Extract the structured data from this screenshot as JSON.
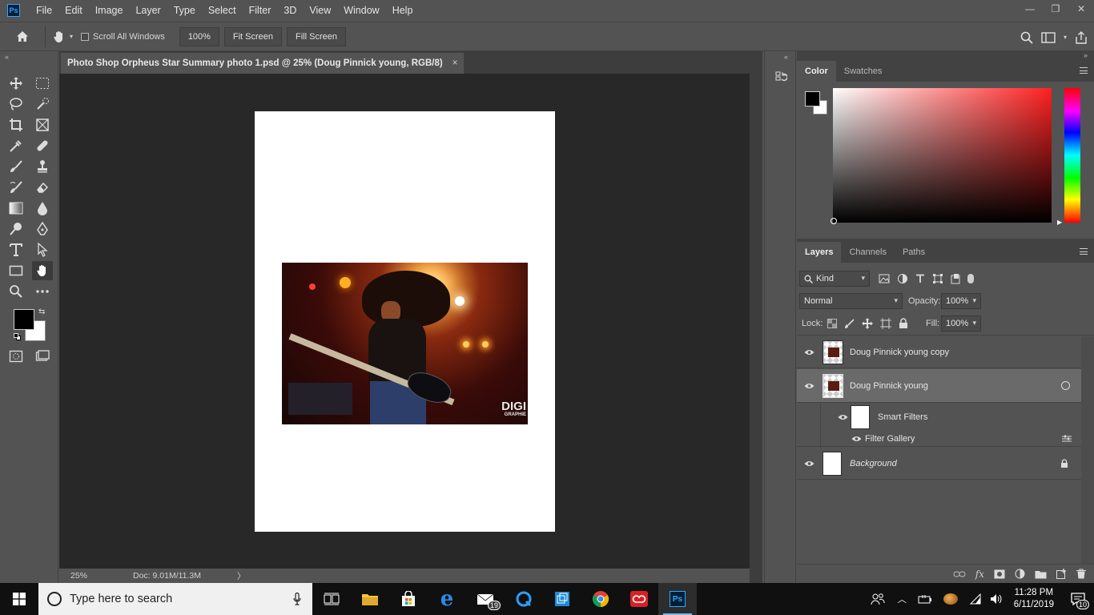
{
  "app": {
    "logo_text": "Ps",
    "menu": [
      "File",
      "Edit",
      "Image",
      "Layer",
      "Type",
      "Select",
      "Filter",
      "3D",
      "View",
      "Window",
      "Help"
    ],
    "window_controls": [
      "—",
      "❐",
      "✕"
    ]
  },
  "options_bar": {
    "scroll_all_windows": "Scroll All Windows",
    "zoom_value": "100%",
    "fit_screen": "Fit Screen",
    "fill_screen": "Fill Screen"
  },
  "document": {
    "tab_title": "Photo Shop Orpheus Star Summary photo 1.psd @ 25% (Doug Pinnick young, RGB/8)",
    "close": "×",
    "status_zoom": "25%",
    "status_doc": "Doc: 9.01M/11.3M",
    "status_arrow": "〉"
  },
  "photo": {
    "watermark": "DIGI",
    "watermark_sub": "GRAPHIE"
  },
  "color_panel": {
    "tabs": [
      "Color",
      "Swatches"
    ],
    "active_tab": "Color"
  },
  "layers_panel": {
    "tabs": [
      "Layers",
      "Channels",
      "Paths"
    ],
    "active_tab": "Layers",
    "filter_kind": "Kind",
    "blend_mode": "Normal",
    "opacity_label": "Opacity:",
    "opacity_value": "100%",
    "lock_label": "Lock:",
    "fill_label": "Fill:",
    "fill_value": "100%",
    "layers": [
      {
        "name": "Doug Pinnick young copy"
      },
      {
        "name": "Doug Pinnick young"
      },
      {
        "name": "Smart Filters"
      },
      {
        "name": "Filter Gallery"
      },
      {
        "name": "Background"
      }
    ]
  },
  "taskbar": {
    "search_placeholder": "Type here to search",
    "mail_badge": "19",
    "time": "11:28 PM",
    "date": "6/11/2019",
    "notification_count": "10"
  },
  "colors": {
    "ui_bg": "#535353",
    "canvas_bg": "#282828",
    "foreground": "#000000",
    "background": "#ffffff"
  }
}
